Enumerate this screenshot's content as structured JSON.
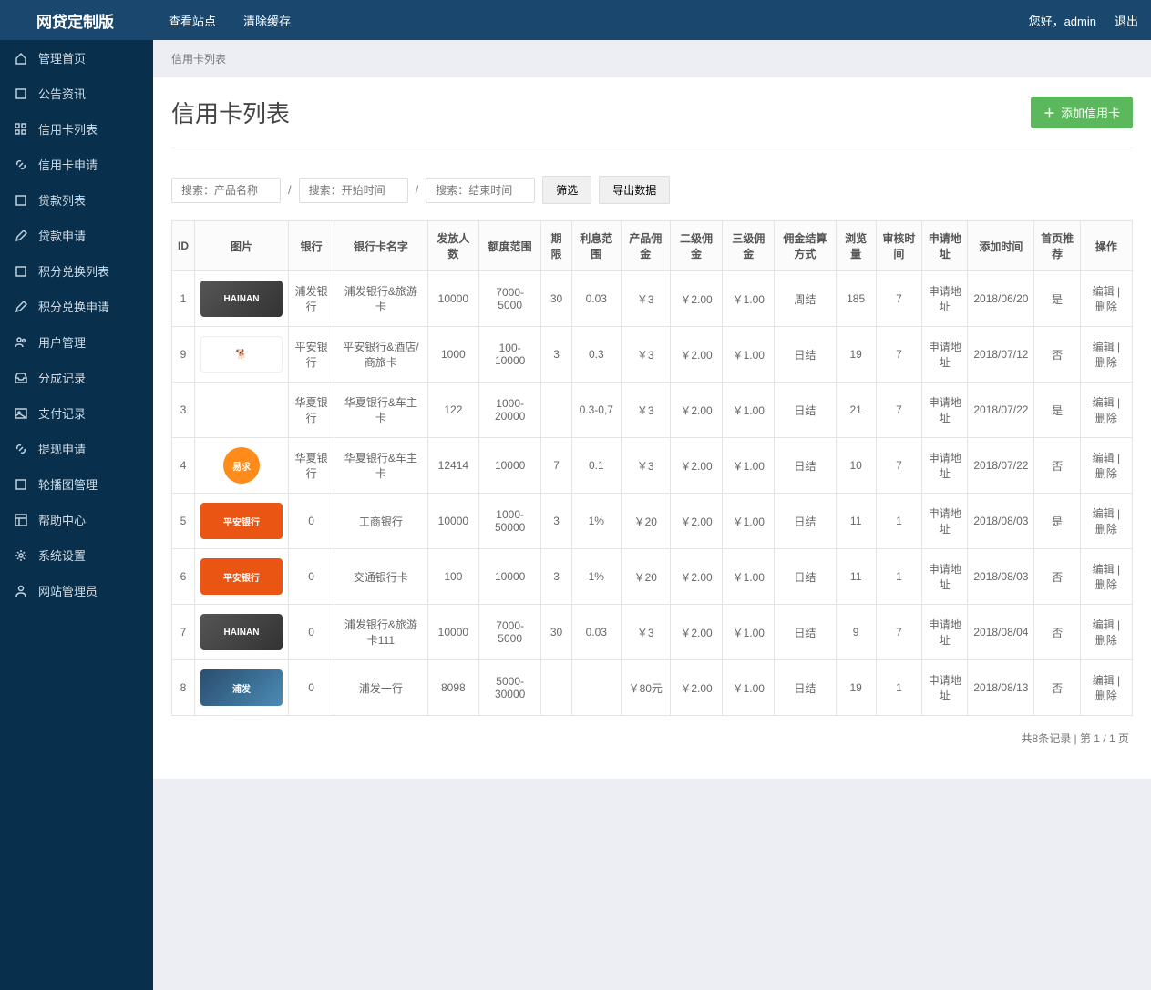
{
  "topbar": {
    "brand": "网贷定制版",
    "view_site": "查看站点",
    "clear_cache": "清除缓存",
    "greeting": "您好，admin",
    "logout": "退出"
  },
  "sidebar": {
    "items": [
      {
        "label": "管理首页",
        "icon": "home"
      },
      {
        "label": "公告资讯",
        "icon": "book"
      },
      {
        "label": "信用卡列表",
        "icon": "grid"
      },
      {
        "label": "信用卡申请",
        "icon": "link"
      },
      {
        "label": "贷款列表",
        "icon": "square"
      },
      {
        "label": "贷款申请",
        "icon": "edit"
      },
      {
        "label": "积分兑换列表",
        "icon": "square"
      },
      {
        "label": "积分兑换申请",
        "icon": "edit"
      },
      {
        "label": "用户管理",
        "icon": "users"
      },
      {
        "label": "分成记录",
        "icon": "inbox"
      },
      {
        "label": "支付记录",
        "icon": "image"
      },
      {
        "label": "提现申请",
        "icon": "link"
      },
      {
        "label": "轮播图管理",
        "icon": "square"
      },
      {
        "label": "帮助中心",
        "icon": "layout"
      },
      {
        "label": "系统设置",
        "icon": "gear"
      },
      {
        "label": "网站管理员",
        "icon": "user"
      }
    ]
  },
  "breadcrumb": "信用卡列表",
  "page": {
    "title": "信用卡列表",
    "add_button": "添加信用卡"
  },
  "filters": {
    "name_placeholder": "搜索：产品名称",
    "start_placeholder": "搜索：开始时间",
    "end_placeholder": "搜索：结束时间",
    "filter_btn": "筛选",
    "export_btn": "导出数据"
  },
  "table": {
    "headers": [
      "ID",
      "图片",
      "银行",
      "银行卡名字",
      "发放人数",
      "额度范围",
      "期限",
      "利息范围",
      "产品佣金",
      "二级佣金",
      "三级佣金",
      "佣金结算方式",
      "浏览量",
      "审核时间",
      "申请地址",
      "添加时间",
      "首页推荐",
      "操作"
    ],
    "rows": [
      {
        "id": "1",
        "thumb": "hainan",
        "bank": "浦发银行",
        "card": "浦发银行&旅游卡",
        "issued": "10000",
        "limit": "7000-5000",
        "term": "30",
        "rate": "0.03",
        "comm": "￥3",
        "c2": "￥2.00",
        "c3": "￥1.00",
        "settle": "周结",
        "views": "185",
        "audit": "7",
        "apply": "申请地址",
        "added": "2018/06/20",
        "rec": "是"
      },
      {
        "id": "9",
        "thumb": "pingan-white",
        "bank": "平安银行",
        "card": "平安银行&酒店/商旅卡",
        "issued": "1000",
        "limit": "100-10000",
        "term": "3",
        "rate": "0.3",
        "comm": "￥3",
        "c2": "￥2.00",
        "c3": "￥1.00",
        "settle": "日结",
        "views": "19",
        "audit": "7",
        "apply": "申请地址",
        "added": "2018/07/12",
        "rec": "否"
      },
      {
        "id": "3",
        "thumb": "yiqiu-orange2",
        "bank": "华夏银行",
        "card": "华夏银行&车主卡",
        "issued": "122",
        "limit": "1000-20000",
        "term": "",
        "rate": "0.3-0,7",
        "comm": "￥3",
        "c2": "￥2.00",
        "c3": "￥1.00",
        "settle": "日结",
        "views": "21",
        "audit": "7",
        "apply": "申请地址",
        "added": "2018/07/22",
        "rec": "是"
      },
      {
        "id": "4",
        "thumb": "yiqiu-orange",
        "bank": "华夏银行",
        "card": "华夏银行&车主卡",
        "issued": "12414",
        "limit": "10000",
        "term": "7",
        "rate": "0.1",
        "comm": "￥3",
        "c2": "￥2.00",
        "c3": "￥1.00",
        "settle": "日结",
        "views": "10",
        "audit": "7",
        "apply": "申请地址",
        "added": "2018/07/22",
        "rec": "否"
      },
      {
        "id": "5",
        "thumb": "pingan-orange",
        "bank": "0",
        "card": "工商银行",
        "issued": "10000",
        "limit": "1000-50000",
        "term": "3",
        "rate": "1%",
        "comm": "￥20",
        "c2": "￥2.00",
        "c3": "￥1.00",
        "settle": "日结",
        "views": "11",
        "audit": "1",
        "apply": "申请地址",
        "added": "2018/08/03",
        "rec": "是"
      },
      {
        "id": "6",
        "thumb": "pingan-orange",
        "bank": "0",
        "card": "交通银行卡",
        "issued": "100",
        "limit": "10000",
        "term": "3",
        "rate": "1%",
        "comm": "￥20",
        "c2": "￥2.00",
        "c3": "￥1.00",
        "settle": "日结",
        "views": "11",
        "audit": "1",
        "apply": "申请地址",
        "added": "2018/08/03",
        "rec": "否"
      },
      {
        "id": "7",
        "thumb": "hainan",
        "bank": "0",
        "card": "浦发银行&旅游卡111",
        "issued": "10000",
        "limit": "7000-5000",
        "term": "30",
        "rate": "0.03",
        "comm": "￥3",
        "c2": "￥2.00",
        "c3": "￥1.00",
        "settle": "日结",
        "views": "9",
        "audit": "7",
        "apply": "申请地址",
        "added": "2018/08/04",
        "rec": "否"
      },
      {
        "id": "8",
        "thumb": "pufa",
        "bank": "0",
        "card": "浦发一行",
        "issued": "8098",
        "limit": "5000-30000",
        "term": "",
        "rate": "",
        "comm": "￥80元",
        "c2": "￥2.00",
        "c3": "￥1.00",
        "settle": "日结",
        "views": "19",
        "audit": "1",
        "apply": "申请地址",
        "added": "2018/08/13",
        "rec": "否"
      }
    ],
    "action_edit": "编辑",
    "action_delete": "删除",
    "action_sep": " | "
  },
  "pagination": "共8条记录 | 第 1 / 1 页"
}
